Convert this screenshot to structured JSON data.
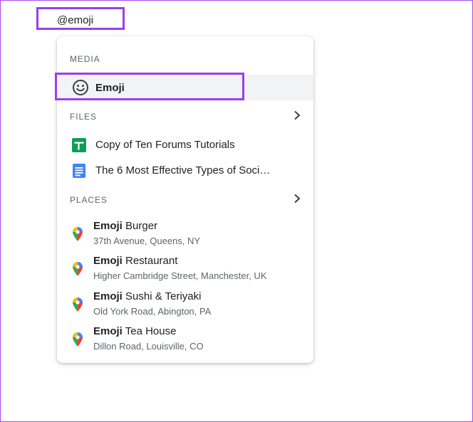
{
  "mention": {
    "text": "@emoji"
  },
  "menu": {
    "media": {
      "header": "MEDIA",
      "item": {
        "label": "Emoji",
        "icon": "smiley-icon"
      }
    },
    "files": {
      "header": "FILES",
      "items": [
        {
          "label": "Copy of Ten Forums Tutorials",
          "icon": "google-sheets-icon",
          "color": "#0f9d58"
        },
        {
          "label": "The 6 Most Effective Types of Soci…",
          "icon": "google-docs-icon",
          "color": "#4285f4"
        }
      ]
    },
    "places": {
      "header": "PLACES",
      "items": [
        {
          "name_bold": "Emoji",
          "name_rest": " Burger",
          "address": "37th Avenue, Queens, NY"
        },
        {
          "name_bold": "Emoji",
          "name_rest": " Restaurant",
          "address": "Higher Cambridge Street, Manchester, UK"
        },
        {
          "name_bold": "Emoji",
          "name_rest": " Sushi & Teriyaki",
          "address": "Old York Road, Abington, PA"
        },
        {
          "name_bold": "Emoji",
          "name_rest": " Tea House",
          "address": "Dillon Road, Louisville, CO"
        }
      ]
    }
  },
  "colors": {
    "highlight_border": "#9a3ff0",
    "frame_border": "#a64cf0",
    "selected_row_bg": "#f1f3f4"
  }
}
